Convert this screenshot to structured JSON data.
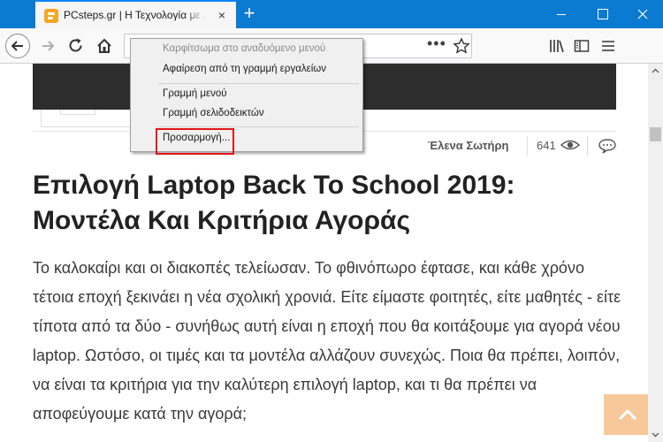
{
  "browser": {
    "tab_title": "PCsteps.gr | Η Τεχνολογία με Απλά Λόγια",
    "tab_close": "×",
    "new_tab": "+",
    "url_dots": "•••"
  },
  "context_menu": {
    "items": [
      {
        "label": "Καρφίτσωμα στο αναδυόμενο μενού",
        "disabled": true
      },
      {
        "label": "Αφαίρεση από τη γραμμή εργαλείων",
        "disabled": false
      },
      {
        "label": "Γραμμή μενού",
        "disabled": false
      },
      {
        "label": "Γραμμή σελιδοδεικτών",
        "disabled": false
      },
      {
        "label": "Προσαρμογή...",
        "disabled": false,
        "highlighted": true
      }
    ]
  },
  "article": {
    "author": "Έλενα Σωτήρη",
    "views": "641",
    "title": "Επιλογή Laptop Back To School 2019: Μοντέλα Και Κριτήρια Αγοράς",
    "body": "Το καλοκαίρι και οι διακοπές τελείωσαν. Το φθινόπωρο έφτασε, και κάθε χρόνο τέτοια εποχή ξεκινάει η νέα σχολική χρονιά. Είτε είμαστε φοιτητές, είτε μαθητές - είτε τίποτα από τα δύο - συνήθως αυτή είναι η εποχή που θα κοιτάξουμε για αγορά νέου laptop. Ωστόσο, οι τιμές και τα μοντέλα αλλάζουν συνεχώς. Ποια θα πρέπει, λοιπόν, να είναι τα κριτήρια για την καλύτερη επιλογή laptop, και τι θα πρέπει να αποφεύγουμε κατά την αγορά;"
  },
  "colors": {
    "titlebar": "#0b7ad1",
    "highlight_box": "#e0161b",
    "back_to_top": "#f7c99a"
  },
  "icons": [
    "tab-favicon-icon",
    "back-arrow-icon",
    "forward-arrow-icon",
    "reload-icon",
    "home-icon",
    "page-actions-icon",
    "bookmark-star-icon",
    "library-icon",
    "sidebar-icon",
    "hamburger-menu-icon",
    "eye-icon",
    "comment-icon",
    "chevron-up-icon"
  ]
}
